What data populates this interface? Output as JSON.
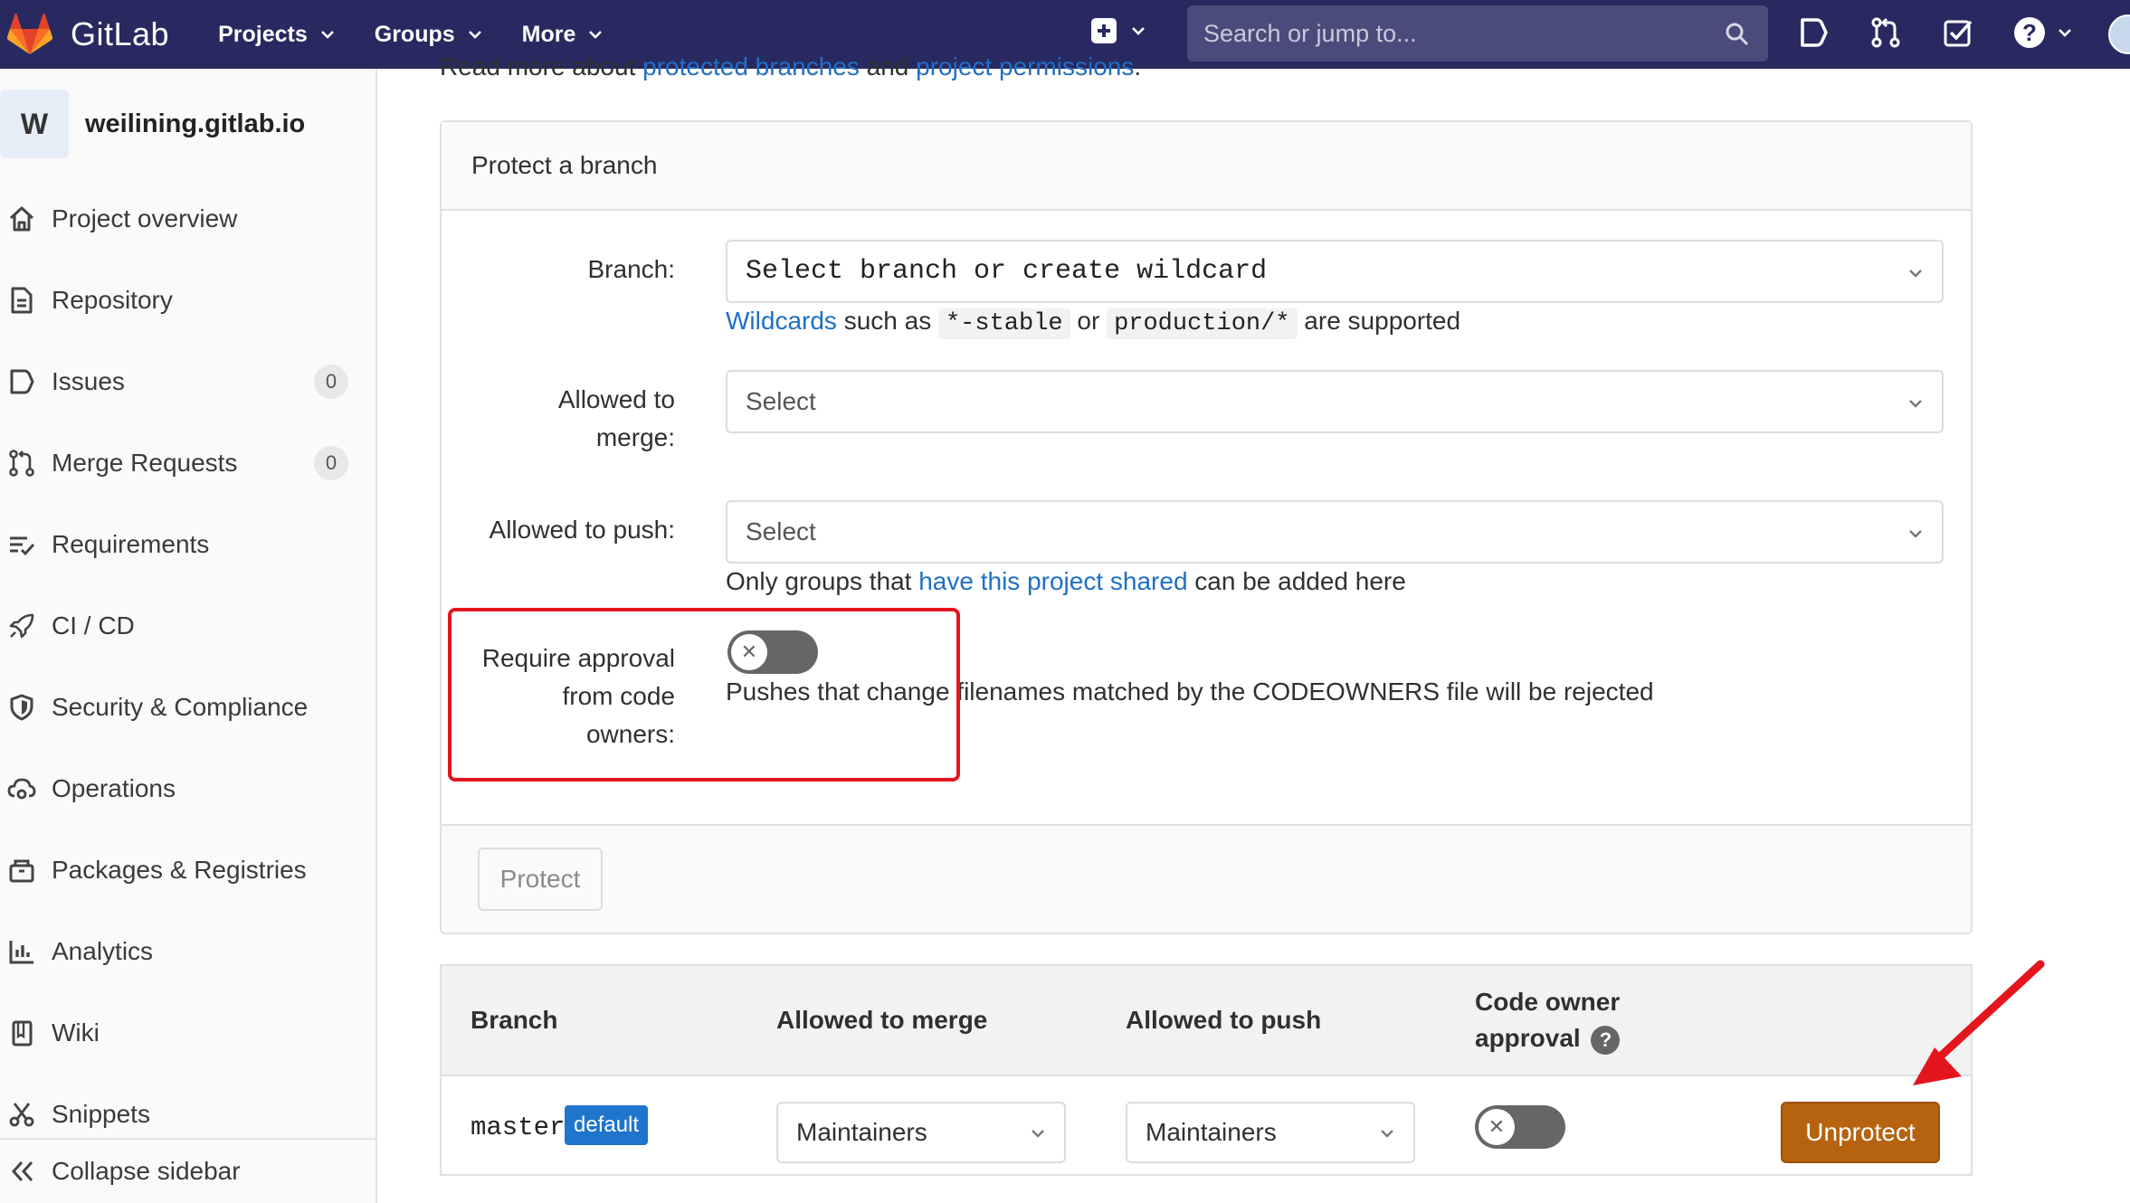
{
  "navbar": {
    "brand": "GitLab",
    "menu": [
      {
        "label": "Projects"
      },
      {
        "label": "Groups"
      },
      {
        "label": "More"
      }
    ],
    "search_placeholder": "Search or jump to...",
    "help_glyph": "?"
  },
  "sidebar": {
    "project_initial": "W",
    "project_name": "weilining.gitlab.io",
    "items": [
      {
        "label": "Project overview",
        "icon": "home-icon"
      },
      {
        "label": "Repository",
        "icon": "document-icon"
      },
      {
        "label": "Issues",
        "icon": "issues-icon",
        "count": "0"
      },
      {
        "label": "Merge Requests",
        "icon": "merge-request-icon",
        "count": "0"
      },
      {
        "label": "Requirements",
        "icon": "requirements-icon"
      },
      {
        "label": "CI / CD",
        "icon": "rocket-icon"
      },
      {
        "label": "Security & Compliance",
        "icon": "shield-icon"
      },
      {
        "label": "Operations",
        "icon": "cloud-gear-icon"
      },
      {
        "label": "Packages & Registries",
        "icon": "package-icon"
      },
      {
        "label": "Analytics",
        "icon": "chart-icon"
      },
      {
        "label": "Wiki",
        "icon": "book-icon"
      },
      {
        "label": "Snippets",
        "icon": "scissors-icon"
      }
    ],
    "collapse_label": "Collapse sidebar"
  },
  "readmore": {
    "prefix": "Read more about ",
    "link1": "protected branches",
    "middle": " and ",
    "link2": "project permissions",
    "suffix": "."
  },
  "protect_form": {
    "title": "Protect a branch",
    "branch_label": "Branch:",
    "branch_placeholder": "Select branch or create wildcard",
    "wildcard_help": {
      "link": "Wildcards",
      "t1": " such as ",
      "code1": "*-stable",
      "t2": " or ",
      "code2": "production/*",
      "t3": " are supported"
    },
    "merge_label_1": "Allowed to",
    "merge_label_2": "merge:",
    "merge_value": "Select",
    "push_label": "Allowed to push:",
    "push_value": "Select",
    "push_help": {
      "t1": "Only groups that ",
      "link": "have this project shared",
      "t2": " can be added here"
    },
    "codeowner_label_1": "Require approval",
    "codeowner_label_2": "from code",
    "codeowner_label_3": "owners:",
    "codeowner_enabled": false,
    "codeowner_help": "Pushes that change filenames matched by the CODEOWNERS file will be rejected",
    "toggle_glyph": "✕",
    "protect_button": "Protect"
  },
  "branches_table": {
    "headers": {
      "branch": "Branch",
      "merge": "Allowed to merge",
      "push": "Allowed to push",
      "codeowner_1": "Code owner",
      "codeowner_2": "approval",
      "help_glyph": "?"
    },
    "rows": [
      {
        "branch": "master",
        "badge": "default",
        "merge": "Maintainers",
        "push": "Maintainers",
        "codeowner_enabled": false,
        "action": "Unprotect"
      }
    ]
  },
  "colors": {
    "navbar": "#292961",
    "link": "#1f6fc5",
    "badge": "#1f75cb",
    "unprotect": "#b5630f",
    "highlight": "#e5151d"
  }
}
